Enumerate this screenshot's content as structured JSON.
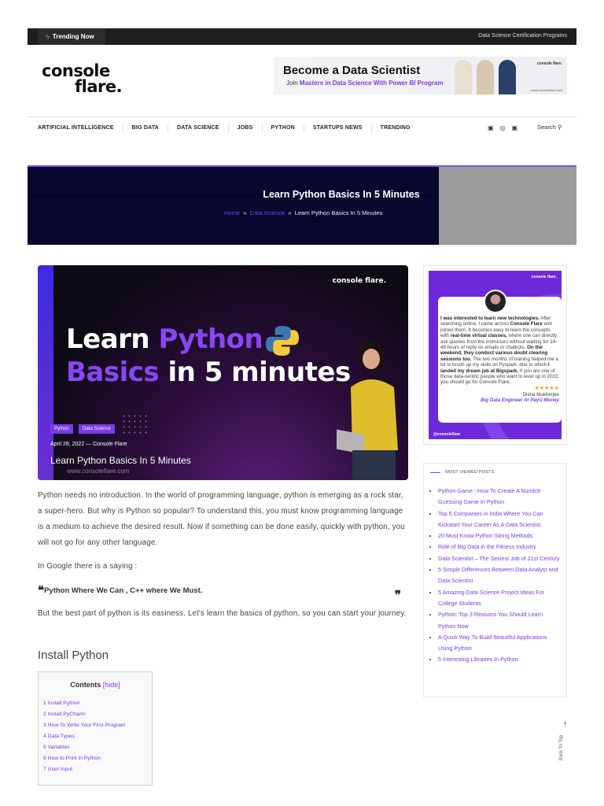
{
  "topbar": {
    "trending_label": "Trending Now",
    "right_link": "Data Science Certification Programs"
  },
  "logo": {
    "line1": "console",
    "line2": "flare."
  },
  "ad": {
    "headline": "Become a Data Scientist",
    "sub_prefix": "Join",
    "sub_highlight": "Masters in Data Science With Power BI Program",
    "brand": "console flare.",
    "url": "www.consoleflare.com"
  },
  "nav": {
    "items": [
      "ARTIFICIAL INTELLIGENCE",
      "BIG DATA",
      "DATA SCIENCE",
      "JOBS",
      "PYTHON",
      "STARTUPS NEWS",
      "TRENDING"
    ],
    "search": "Search"
  },
  "hero": {
    "title": "Learn Python Basics In 5 Minutes",
    "breadcrumb": [
      "Home",
      "Data Science",
      "Learn Python Basics In 5 Minutes"
    ],
    "sep": "»"
  },
  "featured": {
    "line1a": "Learn ",
    "line1b": "Python",
    "line2a": "Basics",
    "line2b": " in 5 minutes",
    "brand": "console flare.",
    "tags": [
      "Python",
      "Data Science"
    ],
    "meta": "April 28, 2022 — Console Flare",
    "title": "Learn Python Basics In 5 Minutes",
    "url": "www.consoleflare.com"
  },
  "article": {
    "p1": "Python needs no introduction. In the world of programming language, python is emerging as a rock star, a super-hero. But why is Python so popular? To understand this, you must know programming language is a medium to achieve the desired result. Now if something can be done easily, quickly with python, you will not go for any other language.",
    "p2": "In Google there is a saying :",
    "quote": "Python Where We Can , C++ where We Must.",
    "p3": "But the best part of python is its easiness. Let's learn the basics of python, so you can start your journey.",
    "h2": "Install Python",
    "toc": {
      "title": "Contents",
      "toggle": "[hide]",
      "items": [
        "1 Install Python",
        "2 Install PyCharm",
        "3 How To Write Your First Program",
        "4 Data Types",
        "5 Variables",
        "6 How to Print in Python",
        "7 User Input"
      ]
    }
  },
  "testimonial": {
    "brand": "console flare.",
    "b1": "I was interested to learn new technologies.",
    "t1": " After searching online, I came across ",
    "b2": "Console Flare",
    "t2": " and joined them. It becomes easy to learn the concepts with ",
    "b3": "real-time virtual classes,",
    "t3": " where one can directly ask queries from the instructors without waiting for 24-48 hours of reply on emails or chatbots. ",
    "b4": "On the weekend, they conduct various doubt clearing sessions too.",
    "t4": " The two months of training helped me a lot to brush up my skills on Pyspark, due to which ",
    "b5": "I landed my dream job at Bigspark.",
    "t5": " If you are one of those data-centric people who want to level up in 2022, you should go for Console Flare.",
    "stars": "★★★★★",
    "name": "Disha Mukherjee",
    "role": "Big Data Engineer At PayU Money",
    "handle": "@consoleflare"
  },
  "most_viewed": {
    "title": "MOST VIEWED POSTS",
    "items": [
      "Python Game : How To Create A Numb3r Guessing Game In Python",
      "Top 5 Companies in India Where You Can Kickstart Your Career As A Data Scientist",
      "20 Must Know Python String Methods",
      "Role of Big Data in the Fitness Industry",
      "Data Scientist – The Sexiest Job of 21st Century",
      "5 Simple Differences Between Data Analyst and Data Scientist",
      "5 Amazing Data Science Project Ideas For College Students",
      "Python: Top 3 Reasons You Should Learn Python Now",
      "A Quick Way To Build Beautiful Applications Using Python",
      "5 Interesting Libraries In Python"
    ]
  },
  "back_to_top": "Back To Top",
  "colors": {
    "accent": "#7c3aed",
    "topbar": "#1f1f1f",
    "hero_bg": "#05052a"
  }
}
